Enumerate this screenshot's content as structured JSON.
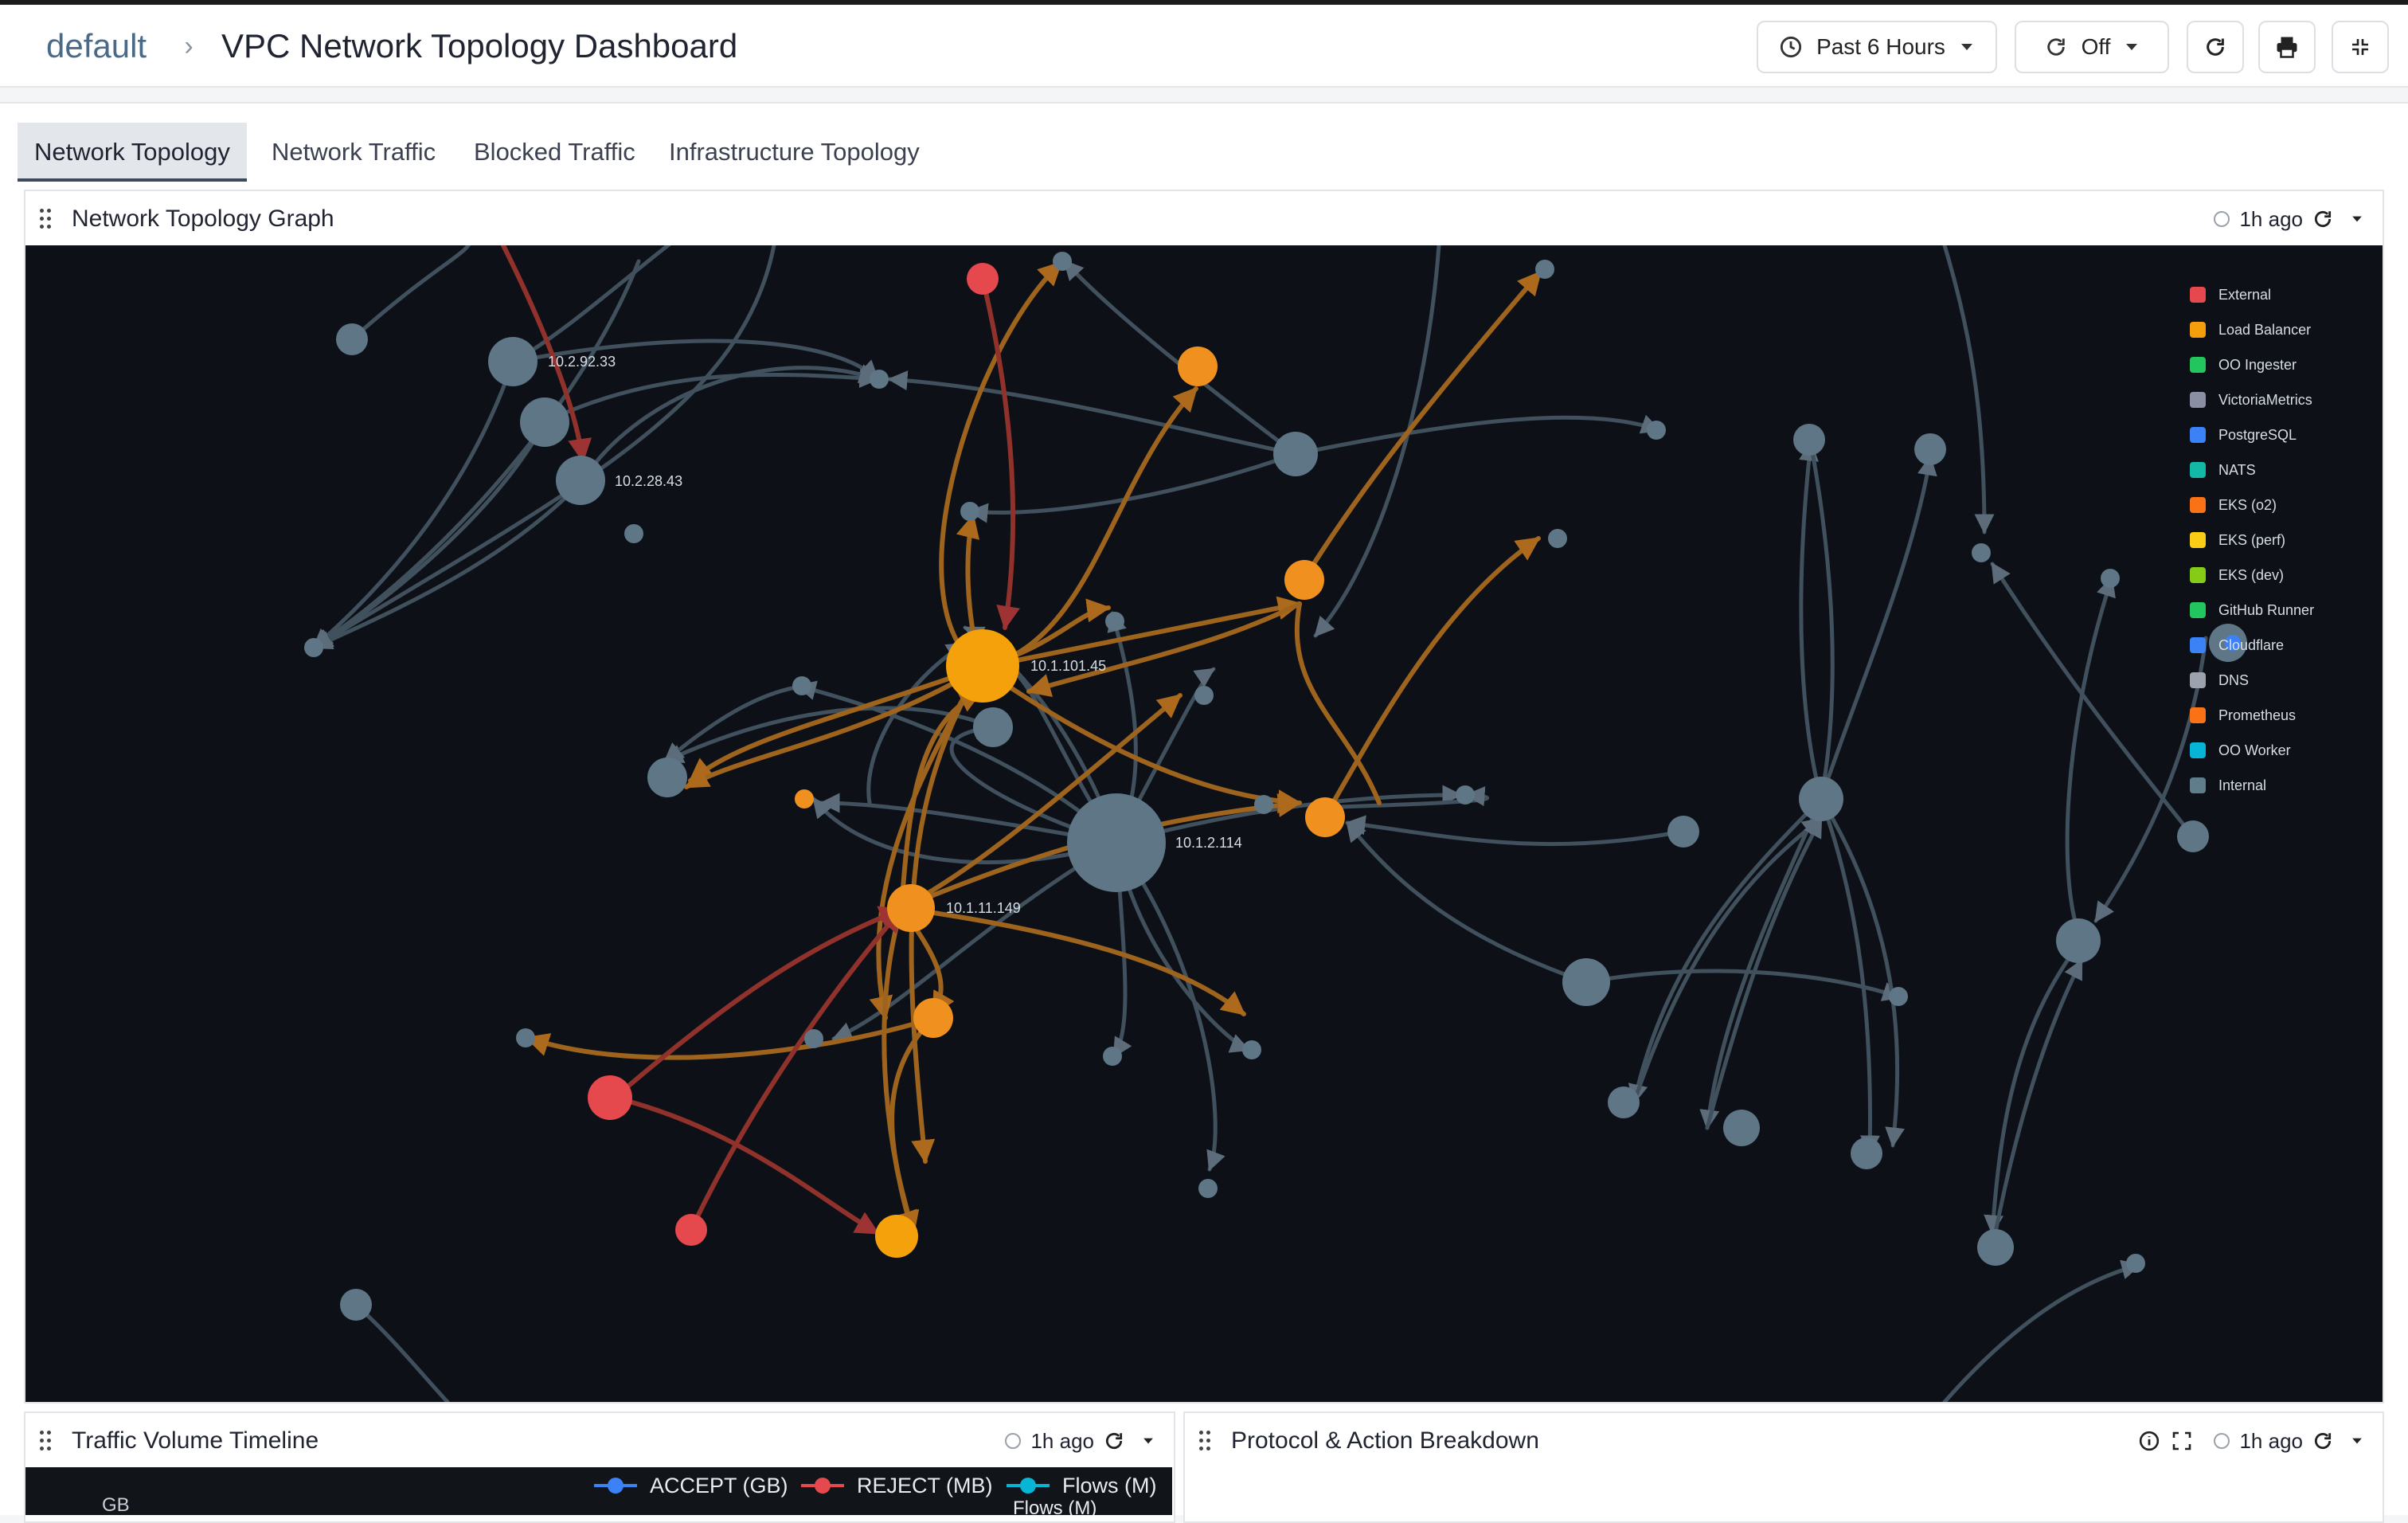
{
  "header": {
    "breadcrumb_root": "default",
    "title": "VPC Network Topology Dashboard",
    "time_range": "Past 6 Hours",
    "refresh_interval": "Off"
  },
  "tabs": [
    {
      "label": "Network Topology",
      "active": true
    },
    {
      "label": "Network Traffic",
      "active": false
    },
    {
      "label": "Blocked Traffic",
      "active": false
    },
    {
      "label": "Infrastructure Topology",
      "active": false
    }
  ],
  "panels": {
    "topology": {
      "title": "Network Topology Graph",
      "updated": "1h ago"
    },
    "timeline": {
      "title": "Traffic Volume Timeline",
      "updated": "1h ago",
      "axis_unit": "GB"
    },
    "protocol": {
      "title": "Protocol & Action Breakdown",
      "updated": "1h ago"
    }
  },
  "legend": [
    {
      "label": "External",
      "color": "#e5484d"
    },
    {
      "label": "Load Balancer",
      "color": "#f59e0b"
    },
    {
      "label": "OO Ingester",
      "color": "#22c55e"
    },
    {
      "label": "VictoriaMetrics",
      "color": "#8b8fa3"
    },
    {
      "label": "PostgreSQL",
      "color": "#3b82f6"
    },
    {
      "label": "NATS",
      "color": "#14b8a6"
    },
    {
      "label": "EKS (o2)",
      "color": "#f97316"
    },
    {
      "label": "EKS (perf)",
      "color": "#facc15"
    },
    {
      "label": "EKS (dev)",
      "color": "#84cc16"
    },
    {
      "label": "GitHub Runner",
      "color": "#22c55e"
    },
    {
      "label": "Cloudflare",
      "color": "#3b82f6"
    },
    {
      "label": "DNS",
      "color": "#9ca3af"
    },
    {
      "label": "Prometheus",
      "color": "#f97316"
    },
    {
      "label": "OO Worker",
      "color": "#06b6d4"
    },
    {
      "label": "Internal",
      "color": "#607d8b"
    }
  ],
  "node_labels": [
    "10.2.92.33",
    "10.2.28.43",
    "10.1.101.45",
    "10.1.2.114",
    "10.1.11.149"
  ],
  "timeline_legend": [
    {
      "label": "ACCEPT (GB)",
      "color": "#3b82f6"
    },
    {
      "label": "REJECT (MB)",
      "color": "#e5484d"
    },
    {
      "label": "Flows (M)",
      "color": "#06b6d4"
    },
    {
      "label": "Flows (M)",
      "color": "#06b6d4"
    }
  ]
}
